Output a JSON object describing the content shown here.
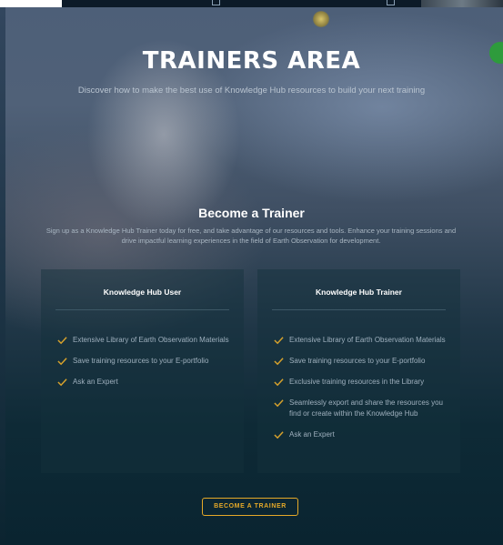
{
  "hero": {
    "title": "TRAINERS AREA",
    "subtitle": "Discover how to make the best use of Knowledge Hub resources to build your next training"
  },
  "section": {
    "title": "Become a Trainer",
    "description": "Sign up as a Knowledge Hub Trainer today for free, and take advantage of our resources and tools. Enhance your training sessions and drive impactful learning experiences in the field of Earth Observation for development."
  },
  "cards": [
    {
      "title": "Knowledge Hub User",
      "features": [
        "Extensive Library of Earth Observation Materials",
        "Save training resources to your E-portfolio",
        "Ask an Expert"
      ]
    },
    {
      "title": "Knowledge Hub Trainer",
      "features": [
        "Extensive Library of Earth Observation Materials",
        "Save training resources to your E-portfolio",
        "Exclusive training resources in the Library",
        "Seamlessly export and share the resources you find or create within the Knowledge Hub",
        "Ask an Expert"
      ]
    }
  ],
  "cta": {
    "label": "BECOME A TRAINER"
  },
  "colors": {
    "accent": "#e5a928",
    "check": "#d9a32c",
    "background": "#0a2430"
  },
  "icons": {
    "feature": "check-icon",
    "thumbnail": "external-link-icon"
  }
}
